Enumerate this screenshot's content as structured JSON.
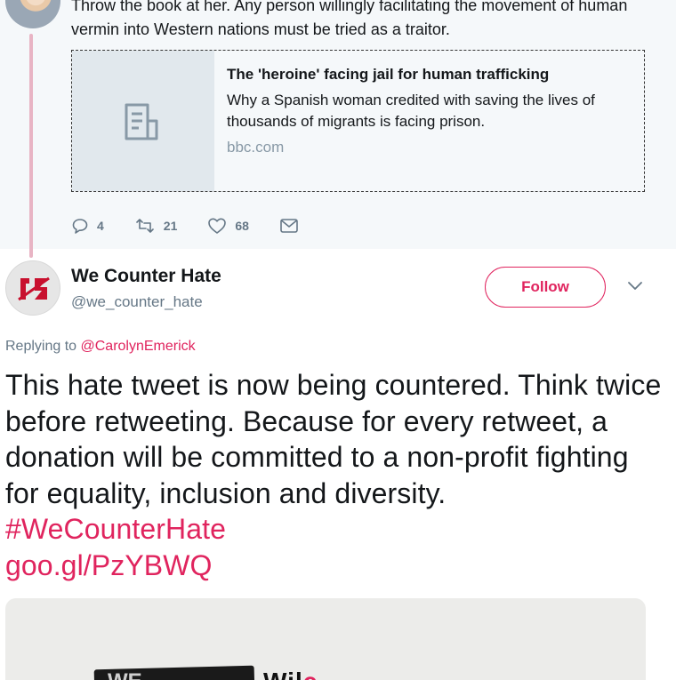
{
  "parent_tweet": {
    "text": "Throw the book at her. Any person willingly facilitating the movement of human vermin into Western nations must be tried as a traitor.",
    "card": {
      "title": "The 'heroine' facing jail for human trafficking",
      "description": "Why a Spanish woman credited with saving the lives of thousands of migrants is facing prison.",
      "domain": "bbc.com"
    },
    "actions": {
      "replies": "4",
      "retweets": "21",
      "likes": "68"
    }
  },
  "reply_tweet": {
    "display_name": "We Counter Hate",
    "handle": "@we_counter_hate",
    "follow_label": "Follow",
    "replying_prefix": "Replying to",
    "replying_to": "@CarolynEmerick",
    "body_text": "This hate tweet is now being countered. Think twice before retweeting. Because for every retweet, a donation will be committed to a non-profit fighting for equality, inclusion and diversity.",
    "hashtag": "#WeCounterHate",
    "link": "goo.gl/PzYBWQ",
    "media": {
      "brush_text": "WE",
      "headline_text": "Wil",
      "headline_accent": "c"
    }
  },
  "colors": {
    "accent": "#e0245e",
    "secondary_text": "#657786",
    "thread_line": "#e8b4c4"
  },
  "icons": [
    "reply-icon",
    "retweet-icon",
    "like-icon",
    "dm-icon",
    "article-icon",
    "chevron-down-icon",
    "wch-logo-icon"
  ]
}
